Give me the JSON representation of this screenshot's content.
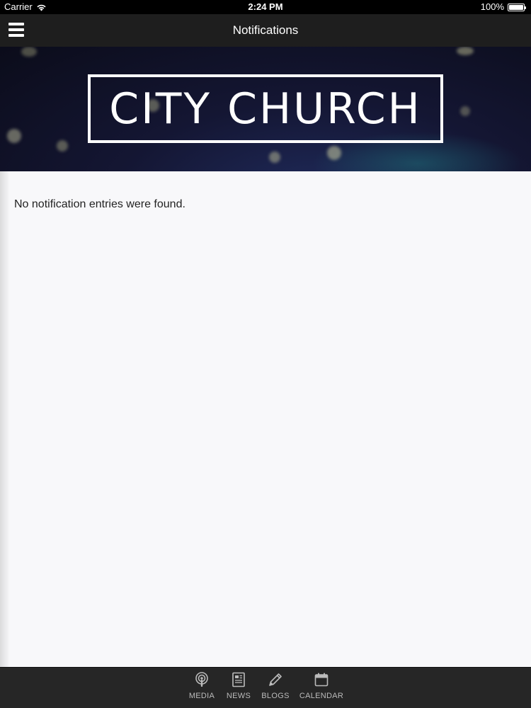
{
  "status_bar": {
    "carrier": "Carrier",
    "time": "2:24 PM",
    "battery": "100%",
    "battery_level": 1.0
  },
  "nav": {
    "title": "Notifications",
    "menu_icon": "hamburger-menu-icon"
  },
  "banner": {
    "logo_text": "CITY CHURCH"
  },
  "content": {
    "empty_message": "No notification entries were found."
  },
  "tab_bar": {
    "tabs": [
      {
        "label": "MEDIA",
        "icon": "podcast-icon"
      },
      {
        "label": "NEWS",
        "icon": "newspaper-icon"
      },
      {
        "label": "BLOGS",
        "icon": "pencil-icon"
      },
      {
        "label": "CALENDAR",
        "icon": "calendar-icon"
      }
    ]
  },
  "colors": {
    "status_bar": "#000000",
    "nav_bar": "#1e1e1e",
    "tab_bar": "#262626",
    "content_bg": "#f8f8fa"
  }
}
